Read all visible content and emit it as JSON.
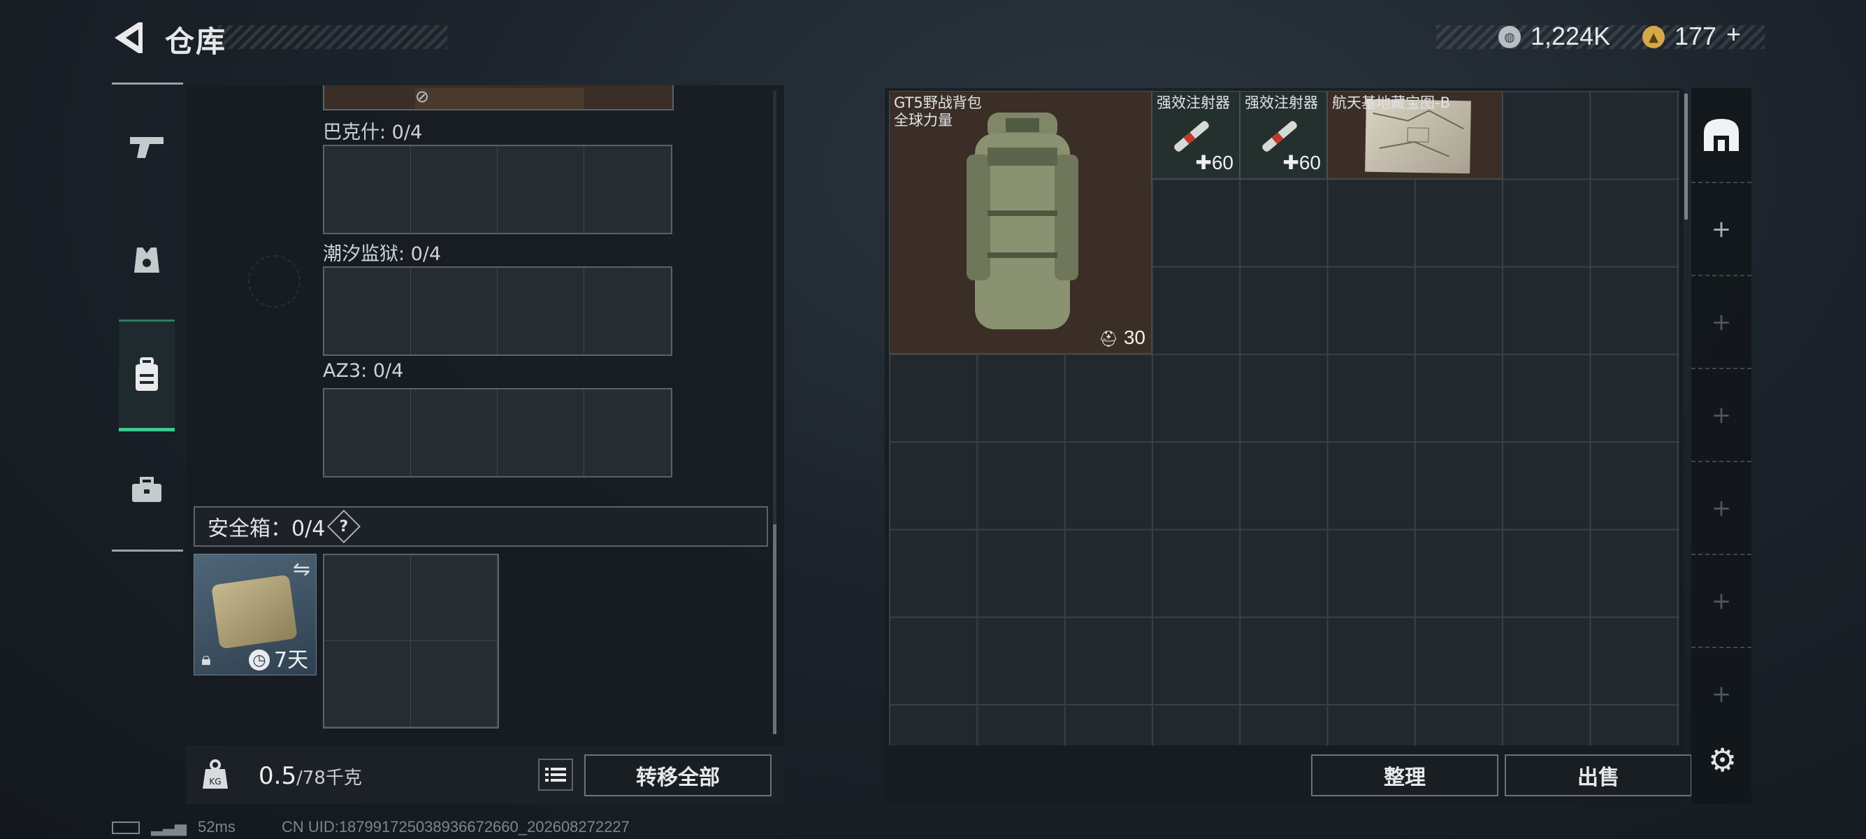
{
  "header": {
    "title": "仓库"
  },
  "currency": {
    "silver": "1,224K",
    "gold": "177",
    "plus": "+"
  },
  "loadout_slots": [
    {
      "label": "巴克什: 0/4"
    },
    {
      "label": "潮汐监狱: 0/4"
    },
    {
      "label": "AZ3: 0/4"
    }
  ],
  "safe_box": {
    "label": "安全箱：0/4",
    "help": "?",
    "duration": "7天"
  },
  "bottom": {
    "weight_value": "0.5",
    "weight_max": "/78千克",
    "transfer_all": "转移全部"
  },
  "inventory": [
    {
      "name": "GT5野战背包",
      "subtitle": "全球力量",
      "count": "30",
      "count_icon": "backpack-icon"
    },
    {
      "name": "强效注射器",
      "count": "60",
      "count_icon": "plus-icon"
    },
    {
      "name": "强效注射器",
      "count": "60",
      "count_icon": "plus-icon"
    },
    {
      "name": "航天基地藏宝图-B"
    }
  ],
  "actions": {
    "sort": "整理",
    "sell": "出售"
  },
  "status": {
    "latency": "52ms",
    "uid": "CN UID:1879917250389366726​60_202608272227"
  },
  "colors": {
    "active_nav": "#3fc890",
    "item_bg": "#3a2e26",
    "injector_bg": "#24302e"
  }
}
